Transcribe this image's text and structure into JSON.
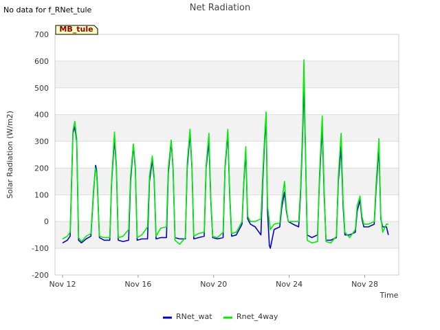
{
  "chart_data": {
    "type": "line",
    "title": "Net Radiation",
    "no_data_note": "No data for f_RNet_tule",
    "site_label": "MB_tule",
    "xlabel": "Time",
    "ylabel": "Solar Radiation (W/m2)",
    "xlim": [
      11.6,
      29.8
    ],
    "ylim": [
      -200,
      700
    ],
    "yticks": [
      -200,
      -100,
      0,
      100,
      200,
      300,
      400,
      500,
      600,
      700
    ],
    "xticks": [
      {
        "value": 12,
        "label": "Nov 12"
      },
      {
        "value": 16,
        "label": "Nov 16"
      },
      {
        "value": 20,
        "label": "Nov 20"
      },
      {
        "value": 24,
        "label": "Nov 24"
      },
      {
        "value": 28,
        "label": "Nov 28"
      }
    ],
    "grid": true,
    "legend_position": "bottom",
    "series": [
      {
        "name": "RNet_wat",
        "color": "#0000cc",
        "points": [
          [
            12.0,
            -80
          ],
          [
            12.25,
            -70
          ],
          [
            12.4,
            -55
          ],
          [
            12.55,
            330
          ],
          [
            12.65,
            355
          ],
          [
            12.75,
            300
          ],
          [
            12.85,
            -70
          ],
          [
            13.0,
            -80
          ],
          [
            13.25,
            -65
          ],
          [
            13.5,
            -55
          ],
          [
            13.65,
            120
          ],
          [
            13.75,
            210
          ],
          [
            13.8,
            195
          ],
          [
            13.85,
            130
          ],
          [
            13.95,
            -60
          ],
          [
            14.2,
            -70
          ],
          [
            14.5,
            -70
          ],
          [
            14.6,
            150
          ],
          [
            14.75,
            310
          ],
          [
            14.85,
            200
          ],
          [
            14.95,
            -70
          ],
          [
            15.2,
            -75
          ],
          [
            15.5,
            -70
          ],
          [
            15.6,
            150
          ],
          [
            15.75,
            285
          ],
          [
            15.85,
            200
          ],
          [
            15.95,
            -70
          ],
          [
            16.2,
            -65
          ],
          [
            16.5,
            -65
          ],
          [
            16.6,
            150
          ],
          [
            16.75,
            230
          ],
          [
            16.85,
            160
          ],
          [
            16.95,
            -65
          ],
          [
            17.2,
            -60
          ],
          [
            17.5,
            -60
          ],
          [
            17.6,
            180
          ],
          [
            17.75,
            300
          ],
          [
            17.85,
            200
          ],
          [
            17.95,
            -60
          ],
          [
            18.2,
            -65
          ],
          [
            18.5,
            -65
          ],
          [
            18.6,
            200
          ],
          [
            18.75,
            330
          ],
          [
            18.85,
            200
          ],
          [
            18.95,
            -65
          ],
          [
            19.2,
            -60
          ],
          [
            19.5,
            -55
          ],
          [
            19.6,
            200
          ],
          [
            19.75,
            300
          ],
          [
            19.85,
            80
          ],
          [
            19.95,
            -60
          ],
          [
            20.2,
            -65
          ],
          [
            20.5,
            -60
          ],
          [
            20.6,
            200
          ],
          [
            20.75,
            330
          ],
          [
            20.85,
            100
          ],
          [
            20.95,
            -55
          ],
          [
            21.2,
            -50
          ],
          [
            21.5,
            -10
          ],
          [
            21.6,
            150
          ],
          [
            21.7,
            260
          ],
          [
            21.8,
            10
          ],
          [
            21.95,
            -10
          ],
          [
            22.2,
            -20
          ],
          [
            22.5,
            -50
          ],
          [
            22.6,
            150
          ],
          [
            22.7,
            300
          ],
          [
            22.78,
            390
          ],
          [
            22.85,
            40
          ],
          [
            22.95,
            -90
          ],
          [
            23.0,
            -100
          ],
          [
            23.2,
            -30
          ],
          [
            23.5,
            -20
          ],
          [
            23.6,
            50
          ],
          [
            23.75,
            110
          ],
          [
            23.85,
            40
          ],
          [
            23.95,
            0
          ],
          [
            24.2,
            -10
          ],
          [
            24.5,
            -20
          ],
          [
            24.6,
            100
          ],
          [
            24.7,
            300
          ],
          [
            24.78,
            520
          ],
          [
            24.85,
            300
          ],
          [
            24.95,
            -50
          ],
          [
            25.2,
            -60
          ],
          [
            25.5,
            -50
          ],
          [
            25.6,
            150
          ],
          [
            25.75,
            360
          ],
          [
            25.85,
            100
          ],
          [
            25.95,
            -70
          ],
          [
            26.2,
            -70
          ],
          [
            26.5,
            -60
          ],
          [
            26.6,
            150
          ],
          [
            26.75,
            280
          ],
          [
            26.85,
            60
          ],
          [
            26.95,
            -50
          ],
          [
            27.2,
            -50
          ],
          [
            27.5,
            -40
          ],
          [
            27.6,
            40
          ],
          [
            27.75,
            80
          ],
          [
            27.85,
            10
          ],
          [
            27.95,
            -20
          ],
          [
            28.2,
            -20
          ],
          [
            28.5,
            -10
          ],
          [
            28.6,
            120
          ],
          [
            28.75,
            280
          ],
          [
            28.85,
            10
          ],
          [
            28.95,
            -20
          ],
          [
            29.15,
            -20
          ],
          [
            29.25,
            -50
          ]
        ]
      },
      {
        "name": "Rnet_4way",
        "color": "#00ee00",
        "points": [
          [
            12.0,
            -65
          ],
          [
            12.25,
            -55
          ],
          [
            12.4,
            -40
          ],
          [
            12.55,
            340
          ],
          [
            12.65,
            375
          ],
          [
            12.75,
            310
          ],
          [
            12.85,
            -60
          ],
          [
            13.0,
            -75
          ],
          [
            13.25,
            -55
          ],
          [
            13.5,
            -45
          ],
          [
            13.65,
            130
          ],
          [
            13.75,
            200
          ],
          [
            13.8,
            180
          ],
          [
            13.85,
            120
          ],
          [
            13.95,
            -55
          ],
          [
            14.2,
            -60
          ],
          [
            14.5,
            -60
          ],
          [
            14.6,
            160
          ],
          [
            14.75,
            335
          ],
          [
            14.85,
            210
          ],
          [
            14.95,
            -60
          ],
          [
            15.2,
            -55
          ],
          [
            15.5,
            -30
          ],
          [
            15.6,
            170
          ],
          [
            15.75,
            290
          ],
          [
            15.85,
            210
          ],
          [
            15.95,
            -60
          ],
          [
            16.2,
            -50
          ],
          [
            16.5,
            -20
          ],
          [
            16.6,
            170
          ],
          [
            16.75,
            245
          ],
          [
            16.85,
            170
          ],
          [
            16.95,
            -55
          ],
          [
            17.2,
            -25
          ],
          [
            17.5,
            -20
          ],
          [
            17.6,
            200
          ],
          [
            17.75,
            305
          ],
          [
            17.85,
            210
          ],
          [
            17.95,
            -70
          ],
          [
            18.2,
            -85
          ],
          [
            18.5,
            -60
          ],
          [
            18.6,
            220
          ],
          [
            18.75,
            345
          ],
          [
            18.85,
            210
          ],
          [
            18.95,
            -55
          ],
          [
            19.2,
            -45
          ],
          [
            19.5,
            -40
          ],
          [
            19.6,
            210
          ],
          [
            19.75,
            330
          ],
          [
            19.85,
            90
          ],
          [
            19.95,
            -55
          ],
          [
            20.2,
            -60
          ],
          [
            20.5,
            -40
          ],
          [
            20.6,
            210
          ],
          [
            20.75,
            345
          ],
          [
            20.85,
            110
          ],
          [
            20.95,
            -45
          ],
          [
            21.2,
            -40
          ],
          [
            21.5,
            0
          ],
          [
            21.6,
            160
          ],
          [
            21.7,
            280
          ],
          [
            21.8,
            20
          ],
          [
            21.95,
            0
          ],
          [
            22.2,
            0
          ],
          [
            22.5,
            10
          ],
          [
            22.6,
            180
          ],
          [
            22.7,
            320
          ],
          [
            22.78,
            410
          ],
          [
            22.85,
            60
          ],
          [
            22.95,
            0
          ],
          [
            23.0,
            -30
          ],
          [
            23.2,
            -10
          ],
          [
            23.5,
            -5
          ],
          [
            23.6,
            70
          ],
          [
            23.75,
            150
          ],
          [
            23.85,
            50
          ],
          [
            23.95,
            0
          ],
          [
            24.2,
            0
          ],
          [
            24.5,
            0
          ],
          [
            24.6,
            120
          ],
          [
            24.7,
            330
          ],
          [
            24.78,
            605
          ],
          [
            24.85,
            320
          ],
          [
            24.95,
            -70
          ],
          [
            25.2,
            -80
          ],
          [
            25.5,
            -75
          ],
          [
            25.6,
            170
          ],
          [
            25.75,
            395
          ],
          [
            25.85,
            120
          ],
          [
            25.95,
            -75
          ],
          [
            26.2,
            -80
          ],
          [
            26.5,
            -55
          ],
          [
            26.6,
            170
          ],
          [
            26.75,
            330
          ],
          [
            26.85,
            80
          ],
          [
            26.95,
            -40
          ],
          [
            27.2,
            -60
          ],
          [
            27.5,
            -30
          ],
          [
            27.6,
            60
          ],
          [
            27.75,
            95
          ],
          [
            27.85,
            20
          ],
          [
            27.95,
            -10
          ],
          [
            28.2,
            -10
          ],
          [
            28.5,
            0
          ],
          [
            28.6,
            140
          ],
          [
            28.75,
            310
          ],
          [
            28.85,
            20
          ],
          [
            28.95,
            -40
          ],
          [
            29.15,
            -10
          ],
          [
            29.25,
            -10
          ]
        ]
      }
    ]
  }
}
